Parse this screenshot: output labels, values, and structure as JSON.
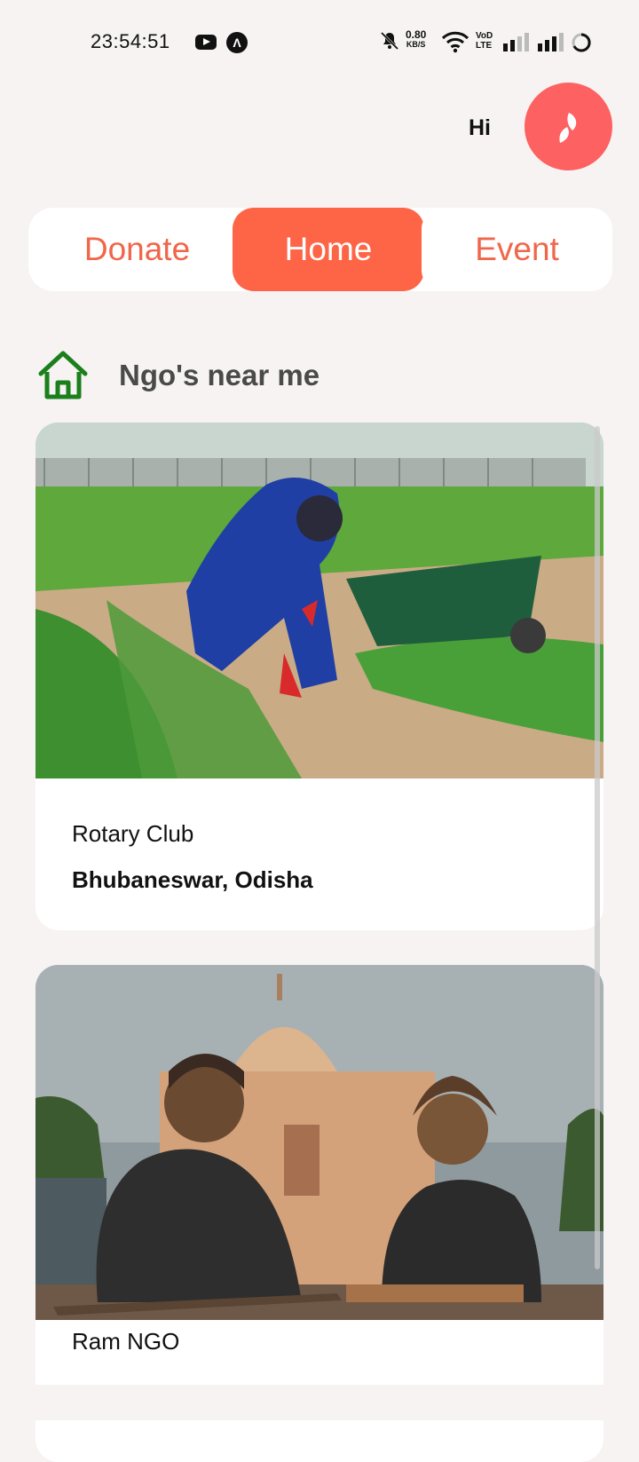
{
  "status_bar": {
    "time": "23:54:51",
    "net_speed_value": "0.80",
    "net_speed_unit": "KB/S",
    "volte_top": "VoD",
    "volte_bottom": "LTE",
    "icons": [
      "youtube-icon",
      "app-a-icon",
      "mute-bell-icon",
      "wifi-icon",
      "signal-icon",
      "signal-icon",
      "battery-icon"
    ]
  },
  "header": {
    "greeting": "Hi",
    "avatar_color": "#fd6161"
  },
  "tabs": [
    {
      "label": "Donate",
      "active": false
    },
    {
      "label": "Home",
      "active": true
    },
    {
      "label": "Event",
      "active": false
    }
  ],
  "section": {
    "title": "Ngo's near me",
    "icon": "home-icon",
    "icon_color": "#1b7f1b"
  },
  "ngos": [
    {
      "name": "Rotary Club",
      "location": "Bhubaneswar, Odisha",
      "image": "farm-worker-photo"
    },
    {
      "name": "Ram NGO",
      "location": "",
      "image": "children-monument-photo"
    }
  ],
  "colors": {
    "accent": "#fe6446",
    "background": "#f6f3f2"
  }
}
